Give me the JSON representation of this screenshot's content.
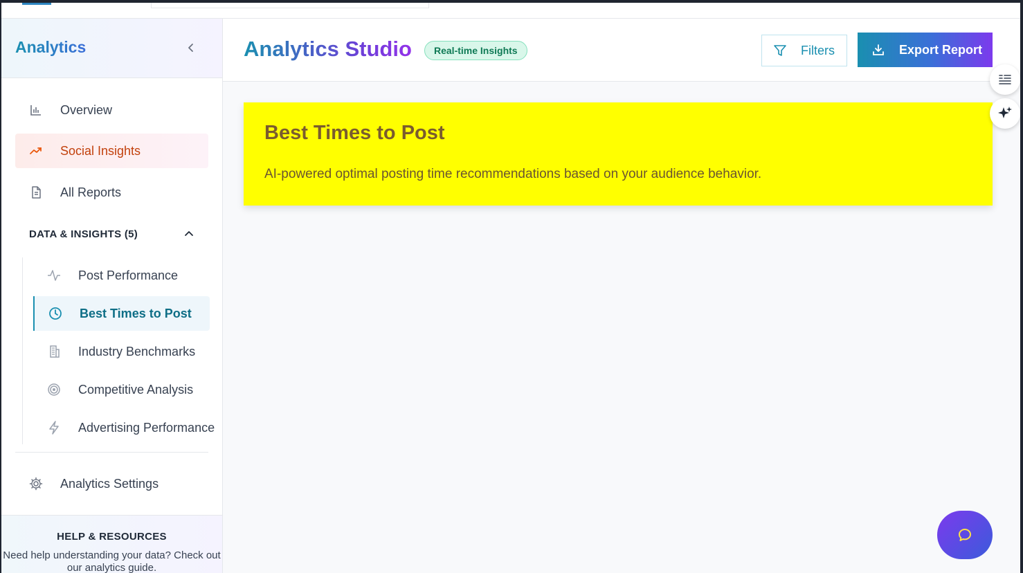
{
  "sidebar": {
    "title": "Analytics",
    "nav": [
      {
        "label": "Overview",
        "icon": "bar-chart-icon"
      },
      {
        "label": "Social Insights",
        "icon": "trending-up-icon",
        "active": true
      },
      {
        "label": "All Reports",
        "icon": "document-icon"
      }
    ],
    "section": {
      "label": "DATA & INSIGHTS (5)",
      "items": [
        {
          "label": "Post Performance",
          "icon": "activity-icon"
        },
        {
          "label": "Best Times to Post",
          "icon": "clock-icon",
          "active": true
        },
        {
          "label": "Industry Benchmarks",
          "icon": "building-icon"
        },
        {
          "label": "Competitive Analysis",
          "icon": "target-icon"
        },
        {
          "label": "Advertising Performance",
          "icon": "lightning-icon"
        }
      ]
    },
    "settings_label": "Analytics Settings",
    "help": {
      "heading": "HELP & RESOURCES",
      "text": "Need help understanding your data? Check out our analytics guide."
    }
  },
  "header": {
    "title_part1": "Analytics",
    "title_part2": "Studio",
    "badge": "Real-time Insights",
    "filters_label": "Filters",
    "export_label": "Export Report"
  },
  "banner": {
    "title": "Best Times to Post",
    "description": "AI-powered optimal posting time recommendations based on your audience behavior."
  },
  "colors": {
    "accent_teal": "#1a8fb0",
    "accent_purple": "#7c3aed",
    "banner_yellow": "#ffff00",
    "active_orange": "#c2410c"
  }
}
